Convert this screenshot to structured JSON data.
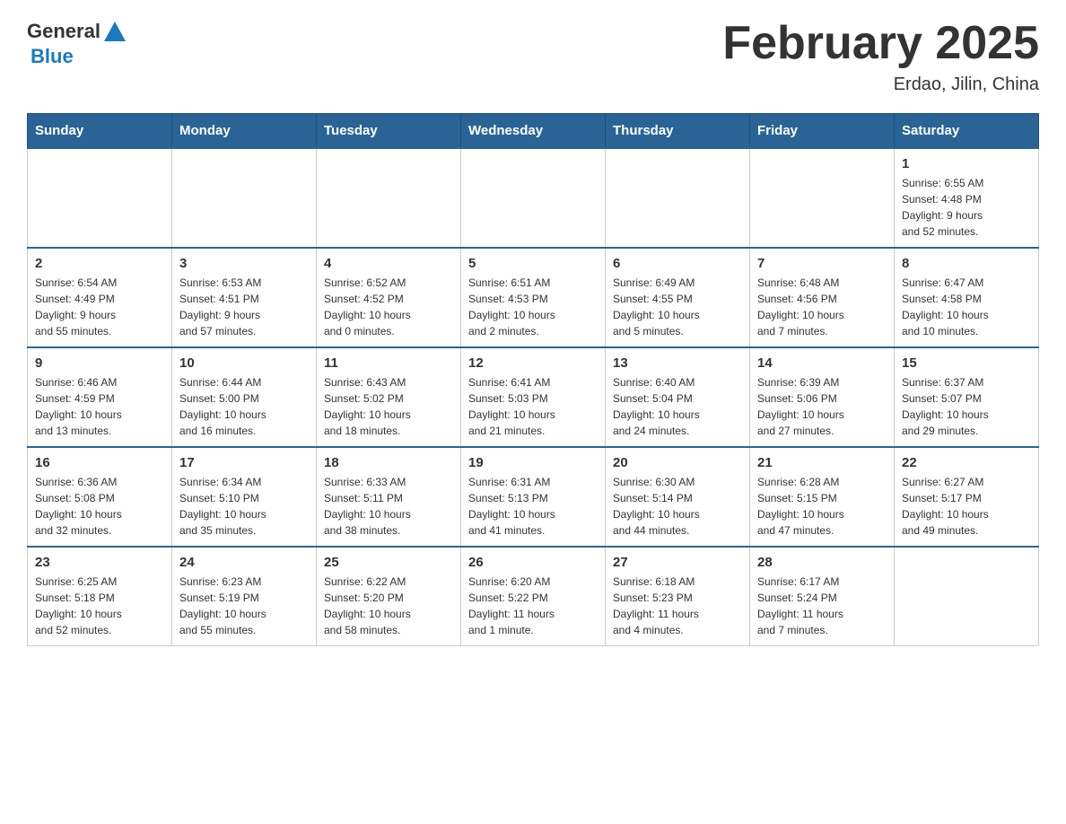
{
  "header": {
    "logo": {
      "general": "General",
      "blue": "Blue"
    },
    "title": "February 2025",
    "subtitle": "Erdao, Jilin, China"
  },
  "weekdays": [
    "Sunday",
    "Monday",
    "Tuesday",
    "Wednesday",
    "Thursday",
    "Friday",
    "Saturday"
  ],
  "weeks": [
    [
      {
        "day": "",
        "info": ""
      },
      {
        "day": "",
        "info": ""
      },
      {
        "day": "",
        "info": ""
      },
      {
        "day": "",
        "info": ""
      },
      {
        "day": "",
        "info": ""
      },
      {
        "day": "",
        "info": ""
      },
      {
        "day": "1",
        "info": "Sunrise: 6:55 AM\nSunset: 4:48 PM\nDaylight: 9 hours\nand 52 minutes."
      }
    ],
    [
      {
        "day": "2",
        "info": "Sunrise: 6:54 AM\nSunset: 4:49 PM\nDaylight: 9 hours\nand 55 minutes."
      },
      {
        "day": "3",
        "info": "Sunrise: 6:53 AM\nSunset: 4:51 PM\nDaylight: 9 hours\nand 57 minutes."
      },
      {
        "day": "4",
        "info": "Sunrise: 6:52 AM\nSunset: 4:52 PM\nDaylight: 10 hours\nand 0 minutes."
      },
      {
        "day": "5",
        "info": "Sunrise: 6:51 AM\nSunset: 4:53 PM\nDaylight: 10 hours\nand 2 minutes."
      },
      {
        "day": "6",
        "info": "Sunrise: 6:49 AM\nSunset: 4:55 PM\nDaylight: 10 hours\nand 5 minutes."
      },
      {
        "day": "7",
        "info": "Sunrise: 6:48 AM\nSunset: 4:56 PM\nDaylight: 10 hours\nand 7 minutes."
      },
      {
        "day": "8",
        "info": "Sunrise: 6:47 AM\nSunset: 4:58 PM\nDaylight: 10 hours\nand 10 minutes."
      }
    ],
    [
      {
        "day": "9",
        "info": "Sunrise: 6:46 AM\nSunset: 4:59 PM\nDaylight: 10 hours\nand 13 minutes."
      },
      {
        "day": "10",
        "info": "Sunrise: 6:44 AM\nSunset: 5:00 PM\nDaylight: 10 hours\nand 16 minutes."
      },
      {
        "day": "11",
        "info": "Sunrise: 6:43 AM\nSunset: 5:02 PM\nDaylight: 10 hours\nand 18 minutes."
      },
      {
        "day": "12",
        "info": "Sunrise: 6:41 AM\nSunset: 5:03 PM\nDaylight: 10 hours\nand 21 minutes."
      },
      {
        "day": "13",
        "info": "Sunrise: 6:40 AM\nSunset: 5:04 PM\nDaylight: 10 hours\nand 24 minutes."
      },
      {
        "day": "14",
        "info": "Sunrise: 6:39 AM\nSunset: 5:06 PM\nDaylight: 10 hours\nand 27 minutes."
      },
      {
        "day": "15",
        "info": "Sunrise: 6:37 AM\nSunset: 5:07 PM\nDaylight: 10 hours\nand 29 minutes."
      }
    ],
    [
      {
        "day": "16",
        "info": "Sunrise: 6:36 AM\nSunset: 5:08 PM\nDaylight: 10 hours\nand 32 minutes."
      },
      {
        "day": "17",
        "info": "Sunrise: 6:34 AM\nSunset: 5:10 PM\nDaylight: 10 hours\nand 35 minutes."
      },
      {
        "day": "18",
        "info": "Sunrise: 6:33 AM\nSunset: 5:11 PM\nDaylight: 10 hours\nand 38 minutes."
      },
      {
        "day": "19",
        "info": "Sunrise: 6:31 AM\nSunset: 5:13 PM\nDaylight: 10 hours\nand 41 minutes."
      },
      {
        "day": "20",
        "info": "Sunrise: 6:30 AM\nSunset: 5:14 PM\nDaylight: 10 hours\nand 44 minutes."
      },
      {
        "day": "21",
        "info": "Sunrise: 6:28 AM\nSunset: 5:15 PM\nDaylight: 10 hours\nand 47 minutes."
      },
      {
        "day": "22",
        "info": "Sunrise: 6:27 AM\nSunset: 5:17 PM\nDaylight: 10 hours\nand 49 minutes."
      }
    ],
    [
      {
        "day": "23",
        "info": "Sunrise: 6:25 AM\nSunset: 5:18 PM\nDaylight: 10 hours\nand 52 minutes."
      },
      {
        "day": "24",
        "info": "Sunrise: 6:23 AM\nSunset: 5:19 PM\nDaylight: 10 hours\nand 55 minutes."
      },
      {
        "day": "25",
        "info": "Sunrise: 6:22 AM\nSunset: 5:20 PM\nDaylight: 10 hours\nand 58 minutes."
      },
      {
        "day": "26",
        "info": "Sunrise: 6:20 AM\nSunset: 5:22 PM\nDaylight: 11 hours\nand 1 minute."
      },
      {
        "day": "27",
        "info": "Sunrise: 6:18 AM\nSunset: 5:23 PM\nDaylight: 11 hours\nand 4 minutes."
      },
      {
        "day": "28",
        "info": "Sunrise: 6:17 AM\nSunset: 5:24 PM\nDaylight: 11 hours\nand 7 minutes."
      },
      {
        "day": "",
        "info": ""
      }
    ]
  ]
}
